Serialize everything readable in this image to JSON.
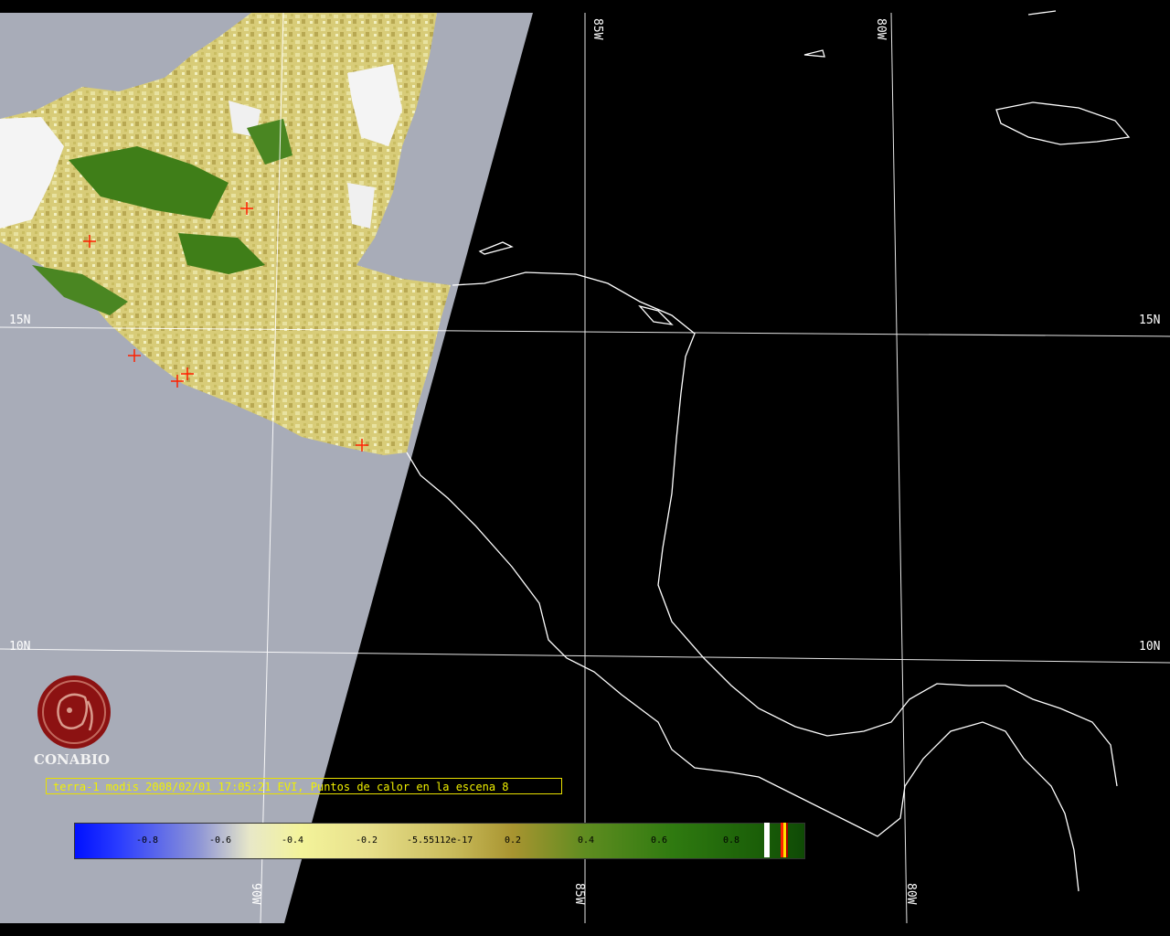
{
  "map": {
    "grid_labels": {
      "lat_15_left": "15N",
      "lat_15_right": "15N",
      "lat_10_left": "10N",
      "lat_10_right": "10N",
      "lon_85_top": "85W",
      "lon_80_top": "80W",
      "lon_90_bottom": "90W",
      "lon_85_bottom": "85W",
      "lon_80_bottom": "80W"
    },
    "colors": {
      "background": "#000000",
      "no_data": "#a8acb8",
      "coastline": "#ffffff",
      "grid": "#ffffff",
      "hotspot": "#ff2000",
      "caption": "#f0f000"
    }
  },
  "caption": "terra-1 modis 2008/02/01 17:05:21 EVI, Puntos de calor en la escena 8",
  "legend": {
    "ticks": [
      "-0.8",
      "-0.6",
      "-0.4",
      "-0.2",
      "-5.55112e-17",
      "0.2",
      "0.4",
      "0.6",
      "0.8"
    ]
  },
  "logo": {
    "name": "CONABIO",
    "icon": "conabio-seal-icon"
  }
}
